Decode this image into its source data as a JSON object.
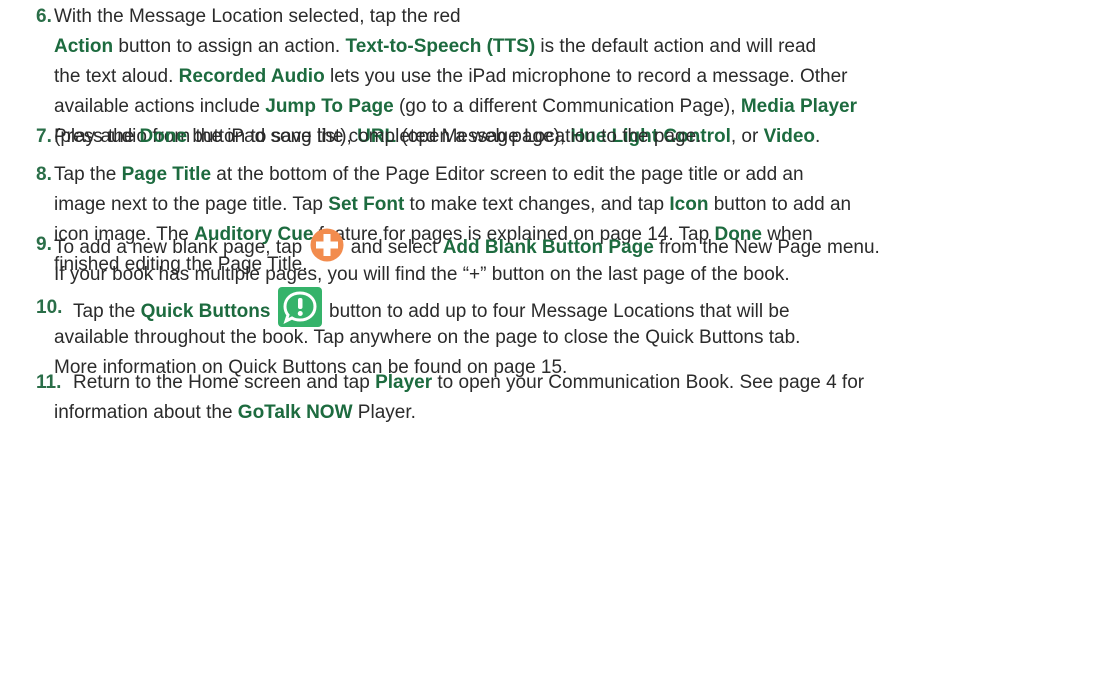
{
  "colors": {
    "accent": "#1d6b3f",
    "step_number": "#2a6e48",
    "plus_icon": "#f28c4e",
    "quick_icon": "#35b36a"
  },
  "steps": [
    {
      "number": "6.",
      "lines": [
        [
          {
            "t": "With the Message Location selected, tap the red"
          }
        ],
        [
          {
            "t": "Action",
            "b": true
          },
          {
            "t": " button to assign an action. "
          },
          {
            "t": "Text-to-Speech (TTS)",
            "b": true
          },
          {
            "t": " is the default action and will read"
          }
        ],
        [
          {
            "t": "the text aloud. "
          },
          {
            "t": "Recorded Audio",
            "b": true
          },
          {
            "t": " lets you use the iPad microphone to record a message. Other"
          }
        ],
        [
          {
            "t": "available actions include "
          },
          {
            "t": "Jump To Page",
            "b": true
          },
          {
            "t": " (go to a different Communication Page), "
          },
          {
            "t": "Media Player",
            "b": true
          }
        ],
        [
          {
            "t": "(play audio from the iPad song list), "
          },
          {
            "t": "URL",
            "b": true
          },
          {
            "t": " (open a web page), "
          },
          {
            "t": "Hue Light Control",
            "b": true
          },
          {
            "t": ", or "
          },
          {
            "t": "Video",
            "b": true
          },
          {
            "t": "."
          }
        ]
      ]
    },
    {
      "number": "7.",
      "lines": [
        [
          {
            "t": "Press the "
          },
          {
            "t": "Done",
            "b": true
          },
          {
            "t": " button to save the completed Message Location to the page."
          }
        ]
      ]
    },
    {
      "number": "8.",
      "lines": [
        [
          {
            "t": "Tap the "
          },
          {
            "t": "Page Title",
            "b": true
          },
          {
            "t": " at the bottom of the Page Editor screen to edit the page title or add an"
          }
        ],
        [
          {
            "t": "image next to the page title. Tap "
          },
          {
            "t": "Set Font",
            "b": true
          },
          {
            "t": " to make text changes, and tap "
          },
          {
            "t": "Icon",
            "b": true
          },
          {
            "t": " button to add an"
          }
        ],
        [
          {
            "t": "icon image.  The "
          },
          {
            "t": "Auditory Cue",
            "b": true
          },
          {
            "t": " feature for pages is explained on page 14. Tap "
          },
          {
            "t": "Done",
            "b": true
          },
          {
            "t": " when"
          }
        ],
        [
          {
            "t": "finished editing the Page Title."
          }
        ]
      ]
    },
    {
      "number": "9.",
      "lines": [
        [
          {
            "t": "To add a new blank page, tap "
          },
          {
            "icon": "plus-icon"
          },
          {
            "t": " and select "
          },
          {
            "t": "Add Blank Button Page",
            "b": true
          },
          {
            "t": " from the New Page menu."
          }
        ],
        [
          {
            "t": "If your book has multiple pages, you will find the “+” button on the last page of the book."
          }
        ]
      ]
    },
    {
      "number": "10.",
      "lines": [
        [
          {
            "t": "Tap the "
          },
          {
            "t": "Quick Buttons",
            "b": true
          },
          {
            "t": " "
          },
          {
            "icon": "quick-buttons-icon"
          },
          {
            "t": " button to add up to four Message Locations that will be"
          }
        ],
        [
          {
            "t": "available throughout the book. Tap anywhere on the page to close the Quick Buttons tab."
          }
        ],
        [
          {
            "t": "More information on Quick Buttons can be found on page 15."
          }
        ]
      ]
    },
    {
      "number": "11.",
      "lines": [
        [
          {
            "t": "Return to the Home screen and tap "
          },
          {
            "t": "Player",
            "b": true
          },
          {
            "t": " to open your Communication Book. See page 4 for"
          }
        ],
        [
          {
            "t": "information about the "
          },
          {
            "t": "GoTalk NOW",
            "b": true
          },
          {
            "t": " Player."
          }
        ]
      ]
    }
  ]
}
